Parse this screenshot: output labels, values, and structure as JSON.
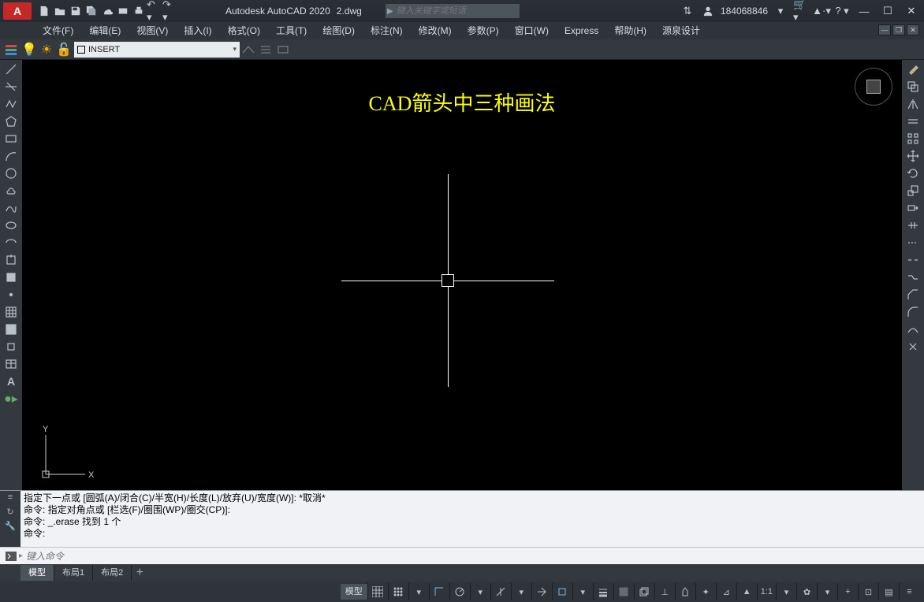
{
  "titlebar": {
    "app_logo_text": "A",
    "app_title": "Autodesk AutoCAD 2020",
    "file_name": "2.dwg",
    "search_placeholder": "键入关键字或短语",
    "user_name": "184068846"
  },
  "menubar": {
    "items": [
      "文件(F)",
      "编辑(E)",
      "视图(V)",
      "插入(I)",
      "格式(O)",
      "工具(T)",
      "绘图(D)",
      "标注(N)",
      "修改(M)",
      "参数(P)",
      "窗口(W)",
      "Express",
      "帮助(H)",
      "源泉设计"
    ]
  },
  "layerbar": {
    "current_layer": "INSERT"
  },
  "canvas": {
    "title_text": "CAD箭头中三种画法",
    "ucs": {
      "x_label": "X",
      "y_label": "Y"
    }
  },
  "command": {
    "history": [
      "指定下一点或 [圆弧(A)/闭合(C)/半宽(H)/长度(L)/放弃(U)/宽度(W)]: *取消*",
      "命令: 指定对角点或 [栏选(F)/圈围(WP)/圈交(CP)]:",
      "命令: _.erase 找到 1 个",
      "命令:"
    ],
    "input_placeholder": "键入命令"
  },
  "tabs": {
    "items": [
      "模型",
      "布局1",
      "布局2"
    ],
    "active_index": 0,
    "add_label": "+"
  },
  "statusbar": {
    "model_label": "模型",
    "scale_label": "1:1"
  }
}
